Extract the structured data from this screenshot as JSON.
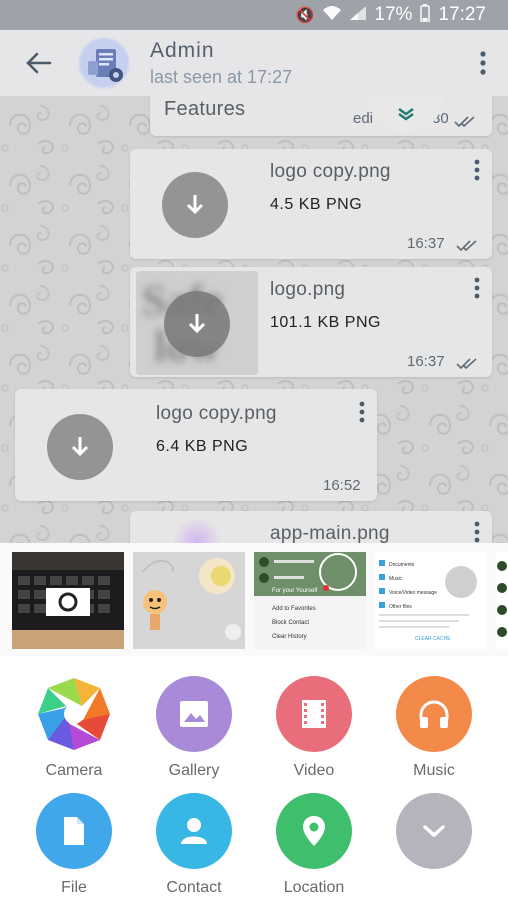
{
  "status_bar": {
    "battery": "17%",
    "time": "17:27"
  },
  "header": {
    "name": "Admin",
    "status": "last seen at 17:27"
  },
  "chat": {
    "features_label": "Features",
    "features_time_partial": "edi",
    "features_time_end": "30",
    "messages": [
      {
        "file_name": "logo copy.png",
        "file_info": "4.5 KB PNG",
        "time": "16:37"
      },
      {
        "file_name": "logo.png",
        "file_info": "101.1 KB PNG",
        "time": "16:37",
        "thumb_text_top": "Safe",
        "thumb_text_bottom": "low"
      },
      {
        "file_name": "logo copy.png",
        "file_info": "6.4 KB PNG",
        "time": "16:52"
      },
      {
        "file_name": "app-main.png"
      }
    ]
  },
  "gallery_previews": {
    "menu_items": [
      "Add to Favorites",
      "Block Contact",
      "Clear History"
    ],
    "settings_items": [
      "Documents",
      "Music",
      "Voice/Video message",
      "Other files"
    ],
    "clear_cache": "CLEAR CACHE",
    "reply_hint": "For your Yourself"
  },
  "actions": [
    {
      "label": "Camera",
      "color": "#ffffff"
    },
    {
      "label": "Gallery",
      "color": "#a88ad8"
    },
    {
      "label": "Video",
      "color": "#e96e7b"
    },
    {
      "label": "Music",
      "color": "#f38a4a"
    },
    {
      "label": "File",
      "color": "#3fa7ea"
    },
    {
      "label": "Contact",
      "color": "#38b7e4"
    },
    {
      "label": "Location",
      "color": "#3fbf6d"
    },
    {
      "label": "",
      "color": "#b6b3bd"
    }
  ]
}
